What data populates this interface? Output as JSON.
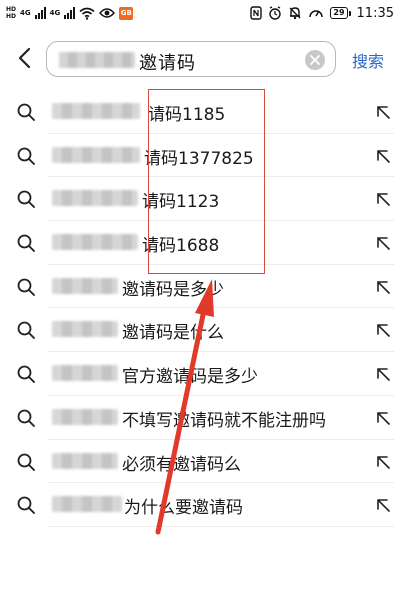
{
  "status_bar": {
    "hd_top": "HD",
    "hd_bottom": "HD",
    "net1": "4G",
    "net2": "4G",
    "app_badge": "GB",
    "battery": "29",
    "time": "11:35"
  },
  "search": {
    "query": "邀请码",
    "submit_label": "搜索"
  },
  "suggestions": [
    {
      "text": "请码1185"
    },
    {
      "text": "请码1377825"
    },
    {
      "text": "请码1123"
    },
    {
      "text": "请码1688"
    },
    {
      "text": "邀请码是多少"
    },
    {
      "text": "邀请码是什么"
    },
    {
      "text": "官方邀请码是多少"
    },
    {
      "text": "不填写邀请码就不能注册吗"
    },
    {
      "text": "必须有邀请码么"
    },
    {
      "text": "为什么要邀请码"
    }
  ],
  "colors": {
    "accent": "#2a66c8",
    "annotation": "#d84a3a"
  }
}
